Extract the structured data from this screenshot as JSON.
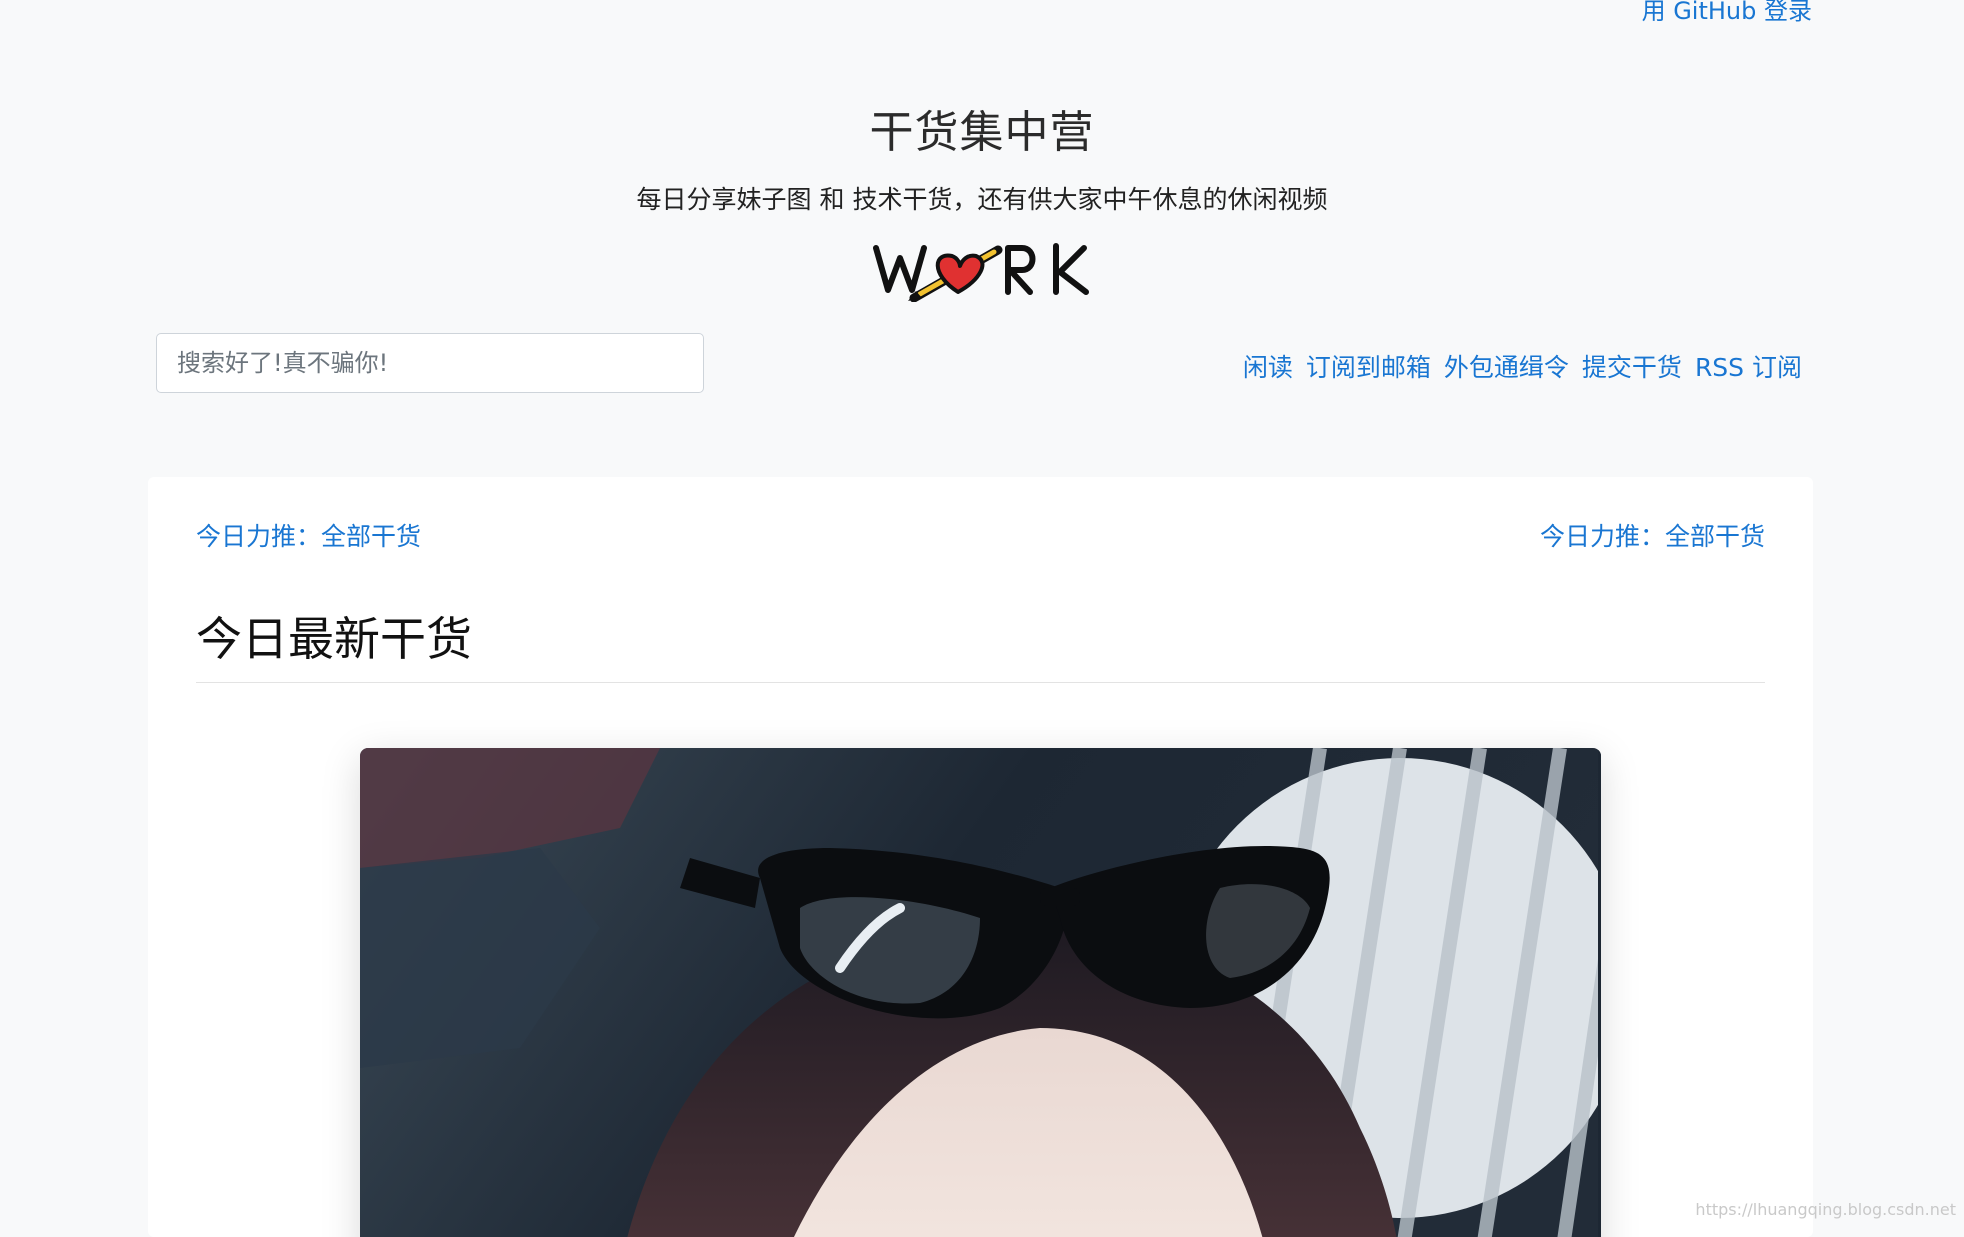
{
  "header": {
    "login_link": "用 GitHub 登录",
    "title": "干货集中营",
    "subtitle": "每日分享妹子图 和 技术干货，还有供大家中午休息的休闲视频",
    "logo_text": "W❤RK"
  },
  "search": {
    "placeholder": "搜索好了!真不骗你!",
    "value": ""
  },
  "nav": {
    "items": [
      {
        "label": "闲读"
      },
      {
        "label": "订阅到邮箱"
      },
      {
        "label": "外包通缉令"
      },
      {
        "label": "提交干货"
      },
      {
        "label": "RSS 订阅"
      }
    ]
  },
  "card": {
    "promo_left": "今日力推：全部干货",
    "promo_right": "今日力推：全部干货",
    "heading": "今日最新干货"
  },
  "watermark": "https://lhuangqing.blog.csdn.net",
  "colors": {
    "link": "#1976d2",
    "page_bg": "#f8f9fa",
    "card_bg": "#ffffff",
    "heart": "#e03131"
  }
}
